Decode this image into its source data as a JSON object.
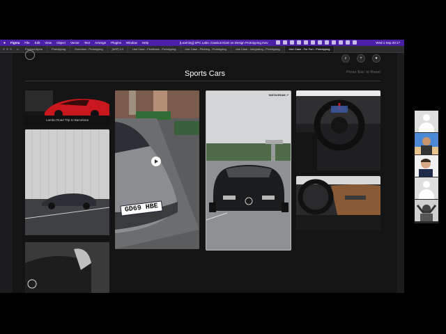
{
  "menubar": {
    "app": "Figma",
    "items": [
      "File",
      "Edit",
      "View",
      "Object",
      "Vector",
      "Text",
      "Arrange",
      "Plugins",
      "Window",
      "Help"
    ],
    "document": "[Learning] SPC Labs: Cassius Kiani on Design Prototyping.mov",
    "clock": "Wed 1 Sep 20:17"
  },
  "tabs": [
    "Product Alpha",
    "Prototyping",
    "Overview - Prototyping",
    "[WIP] 3.0",
    "Use Case - Feedback - Prototyping",
    "Use Case - Pitching - Prototyping",
    "Use Case - Integrating - Prototyping",
    "Use Case - For Fun - Prototyping"
  ],
  "page": {
    "title": "Sports Cars",
    "esc_hint": "Press 'Esc' to Reset"
  },
  "cards": {
    "red_car_caption": "Lambo Road Trip to Barcelona",
    "instagram_label": "INSTAGRAM ↗",
    "plate": "GD69 HBE"
  },
  "colors": {
    "menubar": "#4b1fa8",
    "background": "#141414"
  }
}
